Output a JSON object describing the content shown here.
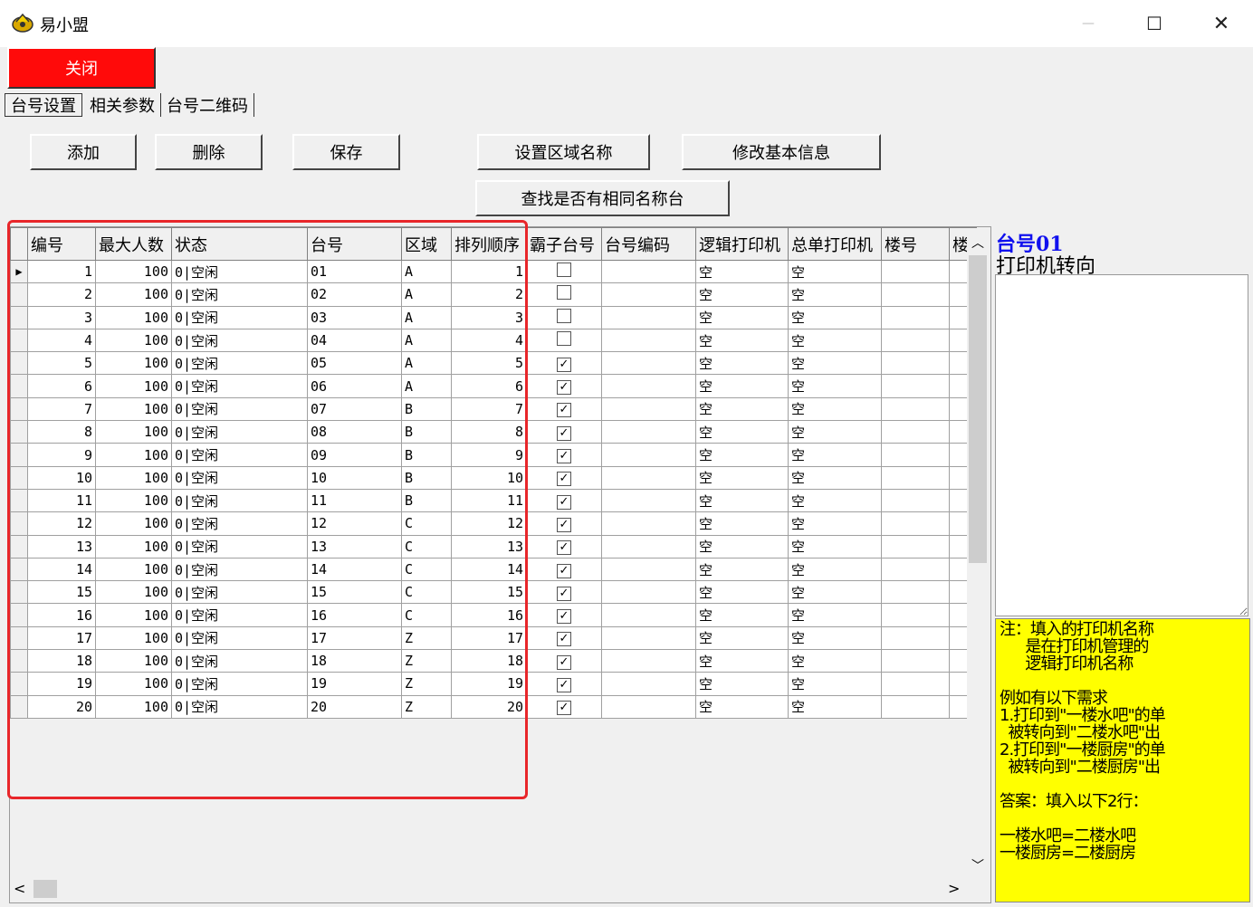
{
  "window": {
    "title": "易小盟",
    "minimize": "—",
    "maximize": "☐",
    "close": "✕"
  },
  "toolbar": {
    "close_label": "关闭"
  },
  "tabs": [
    {
      "label": "台号设置"
    },
    {
      "label": "相关参数"
    },
    {
      "label": "台号二维码"
    }
  ],
  "buttons": {
    "add": "添加",
    "delete": "删除",
    "save": "保存",
    "set_area_name": "设置区域名称",
    "edit_basic_info": "修改基本信息",
    "find_duplicate": "查找是否有相同名称台"
  },
  "grid": {
    "columns": [
      "编号",
      "最大人数",
      "状态",
      "台号",
      "区域",
      "排列顺序",
      "霸子台号",
      "台号编码",
      "逻辑打印机",
      "总单打印机",
      "楼号",
      "楼"
    ],
    "rows": [
      [
        "1",
        "100",
        "0|空闲",
        "01",
        "A",
        "1",
        false,
        "",
        "空",
        "空",
        "",
        ""
      ],
      [
        "2",
        "100",
        "0|空闲",
        "02",
        "A",
        "2",
        false,
        "",
        "空",
        "空",
        "",
        ""
      ],
      [
        "3",
        "100",
        "0|空闲",
        "03",
        "A",
        "3",
        false,
        "",
        "空",
        "空",
        "",
        ""
      ],
      [
        "4",
        "100",
        "0|空闲",
        "04",
        "A",
        "4",
        false,
        "",
        "空",
        "空",
        "",
        ""
      ],
      [
        "5",
        "100",
        "0|空闲",
        "05",
        "A",
        "5",
        true,
        "",
        "空",
        "空",
        "",
        ""
      ],
      [
        "6",
        "100",
        "0|空闲",
        "06",
        "A",
        "6",
        true,
        "",
        "空",
        "空",
        "",
        ""
      ],
      [
        "7",
        "100",
        "0|空闲",
        "07",
        "B",
        "7",
        true,
        "",
        "空",
        "空",
        "",
        ""
      ],
      [
        "8",
        "100",
        "0|空闲",
        "08",
        "B",
        "8",
        true,
        "",
        "空",
        "空",
        "",
        ""
      ],
      [
        "9",
        "100",
        "0|空闲",
        "09",
        "B",
        "9",
        true,
        "",
        "空",
        "空",
        "",
        ""
      ],
      [
        "10",
        "100",
        "0|空闲",
        "10",
        "B",
        "10",
        true,
        "",
        "空",
        "空",
        "",
        ""
      ],
      [
        "11",
        "100",
        "0|空闲",
        "11",
        "B",
        "11",
        true,
        "",
        "空",
        "空",
        "",
        ""
      ],
      [
        "12",
        "100",
        "0|空闲",
        "12",
        "C",
        "12",
        true,
        "",
        "空",
        "空",
        "",
        ""
      ],
      [
        "13",
        "100",
        "0|空闲",
        "13",
        "C",
        "13",
        true,
        "",
        "空",
        "空",
        "",
        ""
      ],
      [
        "14",
        "100",
        "0|空闲",
        "14",
        "C",
        "14",
        true,
        "",
        "空",
        "空",
        "",
        ""
      ],
      [
        "15",
        "100",
        "0|空闲",
        "15",
        "C",
        "15",
        true,
        "",
        "空",
        "空",
        "",
        ""
      ],
      [
        "16",
        "100",
        "0|空闲",
        "16",
        "C",
        "16",
        true,
        "",
        "空",
        "空",
        "",
        ""
      ],
      [
        "17",
        "100",
        "0|空闲",
        "17",
        "Z",
        "17",
        true,
        "",
        "空",
        "空",
        "",
        ""
      ],
      [
        "18",
        "100",
        "0|空闲",
        "18",
        "Z",
        "18",
        true,
        "",
        "空",
        "空",
        "",
        ""
      ],
      [
        "19",
        "100",
        "0|空闲",
        "19",
        "Z",
        "19",
        true,
        "",
        "空",
        "空",
        "",
        ""
      ],
      [
        "20",
        "100",
        "0|空闲",
        "20",
        "Z",
        "20",
        true,
        "",
        "空",
        "空",
        "",
        ""
      ]
    ],
    "selected_row": 0
  },
  "panel": {
    "title": "台号01",
    "subtitle": "打印机转向",
    "note": "注：填入的打印机名称\n      是在打印机管理的\n      逻辑打印机名称\n\n例如有以下需求\n1.打印到\"一楼水吧\"的单\n  被转向到\"二楼水吧\"出\n2.打印到\"一楼厨房\"的单\n  被转向到\"二楼厨房\"出\n\n答案：填入以下2行：\n\n一楼水吧=二楼水吧\n一楼厨房=二楼厨房"
  }
}
